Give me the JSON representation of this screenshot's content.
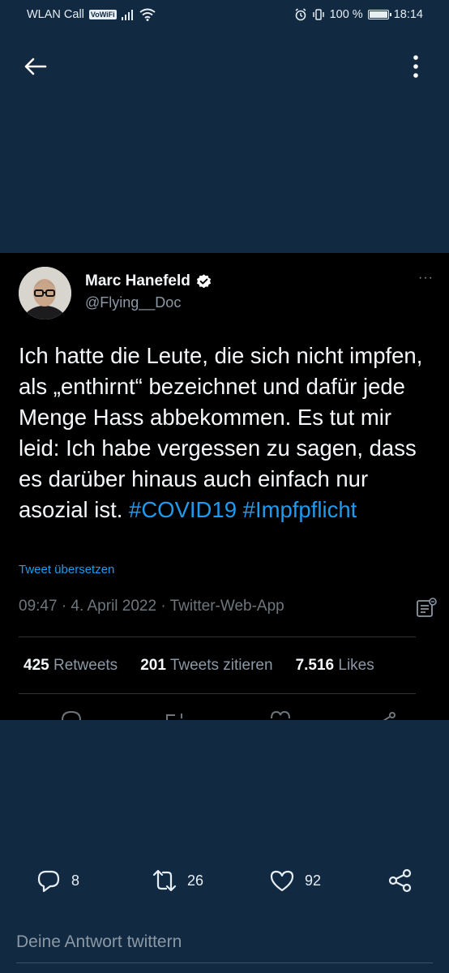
{
  "status_bar": {
    "carrier": "WLAN Call",
    "vowifi": "VoWiFi",
    "battery": "100 %",
    "time": "18:14"
  },
  "tweet": {
    "author_name": "Marc Hanefeld",
    "author_handle": "@Flying__Doc",
    "text": "Ich hatte die Leute, die sich nicht impfen, als „enthirnt“ bezeichnet und dafür jede Menge Hass abbekommen. Es tut mir leid: Ich habe vergessen zu sagen, dass es darüber hinaus auch einfach nur asozial ist.",
    "hashtag1": "#COVID19",
    "hashtag2": "#Impfpflicht",
    "translate_label": "Tweet übersetzen",
    "meta": "09:47 · 4. April 2022  ·  Twitter-Web-App",
    "retweets_count": "425",
    "retweets_label": "Retweets",
    "quotes_count": "201",
    "quotes_label": "Tweets zitieren",
    "likes_count": "7.516",
    "likes_label": "Likes",
    "more_label": "···"
  },
  "actions": {
    "reply_count": "8",
    "retweet_count": "26",
    "like_count": "92"
  },
  "reply": {
    "placeholder": "Deine Antwort twittern"
  },
  "colors": {
    "background": "#122a41",
    "card": "#000000",
    "link": "#1d9bf0",
    "muted": "#8b98a5"
  },
  "icons": [
    "back-arrow-icon",
    "more-vertical-icon",
    "verified-icon",
    "more-horizontal-icon",
    "tweet-details-icon",
    "reply-icon",
    "retweet-icon",
    "like-icon",
    "share-icon",
    "alarm-icon",
    "vibrate-icon",
    "signal-icon",
    "wifi-icon",
    "battery-icon"
  ]
}
